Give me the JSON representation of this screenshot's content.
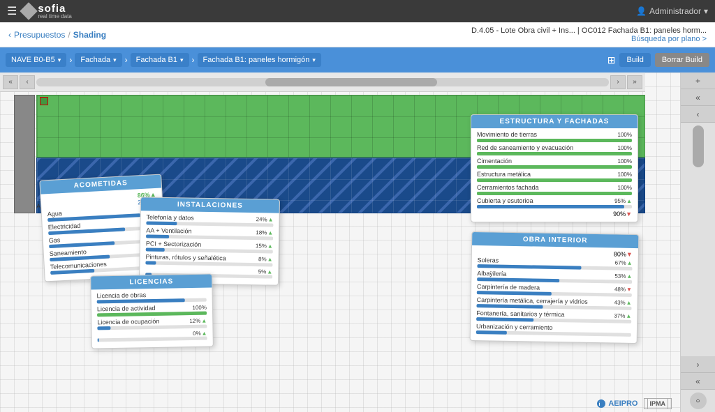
{
  "app": {
    "title": "sofia",
    "subtitle": "real time data"
  },
  "topbar": {
    "admin_label": "Administrador"
  },
  "breadcrumb": {
    "left1": "Presupuestos",
    "separator": "/",
    "left2": "Shading",
    "right_title": "D.4.05 - Lote Obra civil + Ins... | OC012 Fachada B1: paneles horm...",
    "right_link": "Búsqueda por plano >"
  },
  "navbar": {
    "items": [
      {
        "label": "NAVE B0-B5",
        "id": "nave"
      },
      {
        "label": "Fachada",
        "id": "fachada"
      },
      {
        "label": "Fachada B1",
        "id": "fachada-b1"
      },
      {
        "label": "Fachada B1: paneles hormigón",
        "id": "fachada-paneles"
      }
    ],
    "btn_build": "Build",
    "btn_borrar": "Borrar Build"
  },
  "panel_acometidas": {
    "title": "ACOMETIDAS",
    "pct_top": "86%",
    "pct_top2": "24%",
    "items": [
      {
        "label": "Agua",
        "pct": 85,
        "type": "blue"
      },
      {
        "label": "Electricidad",
        "pct": 70,
        "type": "blue"
      },
      {
        "label": "Gas",
        "pct": 60,
        "type": "blue"
      },
      {
        "label": "Saneamiento",
        "pct": 55,
        "type": "blue"
      },
      {
        "label": "Telecomunicaciones",
        "pct": 40,
        "type": "blue"
      }
    ]
  },
  "panel_instalaciones": {
    "title": "INSTALACIONES",
    "items": [
      {
        "label": "Telefonía y datos",
        "pct": 24,
        "arrow": "up",
        "pct_text": "24%"
      },
      {
        "label": "AA + Ventilación",
        "pct": 18,
        "arrow": "up",
        "pct_text": "18%"
      },
      {
        "label": "PCI + Sectorización",
        "pct": 15,
        "arrow": "up",
        "pct_text": "15%"
      },
      {
        "label": "Pinturas, rótulos y señalética",
        "pct": 8,
        "arrow": "up",
        "pct_text": "8%"
      },
      {
        "label": "...",
        "pct": 5,
        "arrow": "up",
        "pct_text": "5%"
      }
    ]
  },
  "panel_licencias": {
    "title": "LICENCIAS",
    "items": [
      {
        "label": "Licencia de obras",
        "pct": 80,
        "type": "blue"
      },
      {
        "label": "Licencia de actividad",
        "pct": 100,
        "pct_text": "100%",
        "type": "green"
      },
      {
        "label": "Licencia de ocupación",
        "pct": 12,
        "pct_text": "12%",
        "arrow": "up"
      },
      {
        "label": "",
        "pct": 0,
        "pct_text": "0%",
        "arrow": "up"
      }
    ]
  },
  "panel_estructura": {
    "title": "ESTRUCTURA Y FACHADAS",
    "items": [
      {
        "label": "Movimiento de tierras",
        "pct": 100,
        "pct_text": "100%",
        "type": "green"
      },
      {
        "label": "Red de saneamiento y evacuación",
        "pct": 100,
        "pct_text": "100%",
        "type": "green"
      },
      {
        "label": "Cimentación",
        "pct": 100,
        "pct_text": "100%",
        "type": "green"
      },
      {
        "label": "Estructura metálica",
        "pct": 100,
        "pct_text": "100%",
        "type": "green"
      },
      {
        "label": "Cerramientos fachada",
        "pct": 100,
        "pct_text": "100%",
        "type": "green"
      },
      {
        "label": "Cubierta y esutorioa",
        "pct": 95,
        "pct_text": "95%",
        "type": "blue",
        "arrow": "up"
      }
    ],
    "extra_pct": "90%",
    "extra_arrow": "down"
  },
  "panel_obra_interior": {
    "title": "OBRA INTERIOR",
    "extra_pct": "80%",
    "extra_arrow": "down",
    "items": [
      {
        "label": "Soleras",
        "pct": 67,
        "pct_text": "67%",
        "arrow": "up"
      },
      {
        "label": "Albaÿilería",
        "pct": 53,
        "pct_text": "53%",
        "arrow": "up"
      },
      {
        "label": "Carpintería de madera",
        "pct": 48,
        "pct_text": "48%",
        "arrow": "down"
      },
      {
        "label": "Carpintería metálica, cerrajería y vidrios",
        "pct": 43,
        "pct_text": "43%",
        "arrow": "up"
      },
      {
        "label": "Fontanería, sanitarios y térmica",
        "pct": 37,
        "pct_text": "37%",
        "arrow": "up"
      },
      {
        "label": "Urbanización y cerramiento",
        "pct": 20,
        "pct_text": "",
        "arrow": ""
      }
    ]
  },
  "footer": {
    "aeipro": "AEIPRO",
    "ipma": "IPMA"
  }
}
